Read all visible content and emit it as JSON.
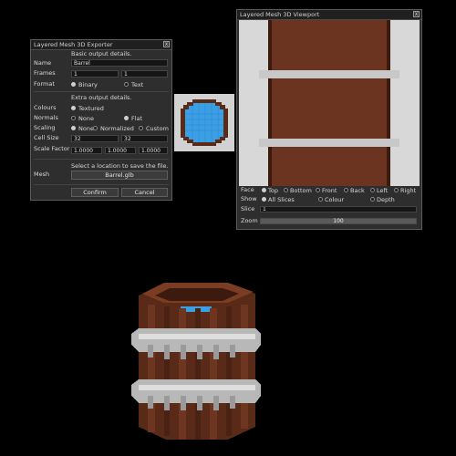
{
  "exporter": {
    "title": "Layered Mesh 3D Exporter",
    "close_label": "x",
    "basic_heading": "Basic output details.",
    "name_label": "Name",
    "name_value": "Barrel",
    "frames_label": "Frames",
    "frames_start": "1",
    "frames_end": "1",
    "format_label": "Format",
    "format_binary": "Binary",
    "format_text": "Text",
    "extra_heading": "Extra output details.",
    "colours_label": "Colours",
    "colours_textured": "Textured",
    "normals_label": "Normals",
    "normals_none": "None",
    "normals_flat": "Flat",
    "scaling_label": "Scaling",
    "scaling_none": "None",
    "scaling_normalized": "Normalized",
    "scaling_custom": "Custom",
    "cell_size_label": "Cell Size",
    "cell_size_x": "32",
    "cell_size_y": "32",
    "scale_factor_label": "Scale Factor",
    "scale_x": "1.0000",
    "scale_y": "1.0000",
    "scale_z": "1.0000",
    "mesh_hint": "Select a location to save the file.",
    "mesh_label": "Mesh",
    "mesh_file": "Barrel.glb",
    "confirm_label": "Confirm",
    "cancel_label": "Cancel"
  },
  "viewport": {
    "title": "Layered Mesh 3D Viewport",
    "face_label": "Face",
    "faces": [
      "Top",
      "Bottom",
      "Front",
      "Back",
      "Left",
      "Right"
    ],
    "show_label": "Show",
    "show_options": [
      "All Slices",
      "Colour",
      "Depth"
    ],
    "slice_label": "Slice",
    "slice_value": "1",
    "zoom_label": "Zoom",
    "zoom_value": "100"
  },
  "colors": {
    "wood": "#6a3420",
    "wood_dark": "#3c1a0e",
    "band": "#c8c8c8",
    "water": "#3b9fe6",
    "panel_bg": "#2e2e2e"
  }
}
